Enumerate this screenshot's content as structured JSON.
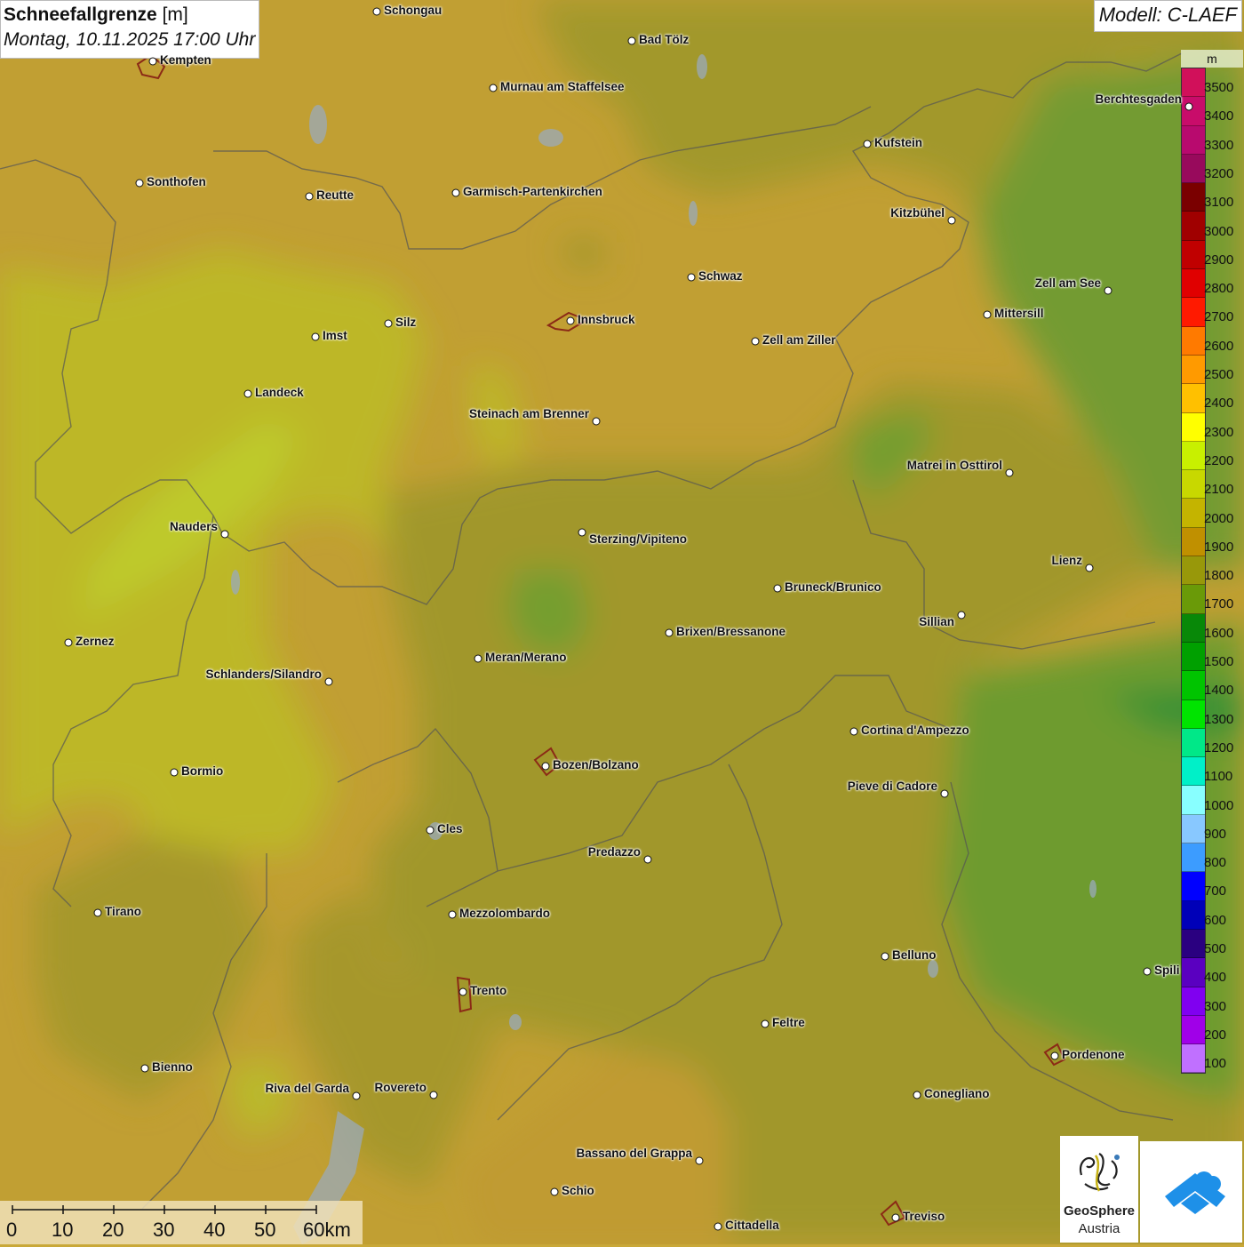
{
  "title": {
    "label_bold": "Schneefallgrenze",
    "unit": "[m]",
    "datetime": "Montag, 10.11.2025 17:00 Uhr"
  },
  "model": "Modell: C-LAEF",
  "legend": {
    "unit": "m",
    "levels": [
      {
        "value": "3500",
        "color": "#d1105a"
      },
      {
        "value": "3400",
        "color": "#c80c6a"
      },
      {
        "value": "3300",
        "color": "#b80a6e"
      },
      {
        "value": "3200",
        "color": "#980a5c"
      },
      {
        "value": "3100",
        "color": "#7a0000"
      },
      {
        "value": "3000",
        "color": "#a00000"
      },
      {
        "value": "2900",
        "color": "#c00000"
      },
      {
        "value": "2800",
        "color": "#e00000"
      },
      {
        "value": "2700",
        "color": "#ff1a00"
      },
      {
        "value": "2600",
        "color": "#ff7a00"
      },
      {
        "value": "2500",
        "color": "#ff9a00"
      },
      {
        "value": "2400",
        "color": "#ffc000"
      },
      {
        "value": "2300",
        "color": "#ffff00"
      },
      {
        "value": "2200",
        "color": "#c8f000"
      },
      {
        "value": "2100",
        "color": "#c8d800"
      },
      {
        "value": "2000",
        "color": "#c4b400"
      },
      {
        "value": "1900",
        "color": "#c09000"
      },
      {
        "value": "1800",
        "color": "#98980a"
      },
      {
        "value": "1700",
        "color": "#6a9a08"
      },
      {
        "value": "1600",
        "color": "#088808"
      },
      {
        "value": "1500",
        "color": "#00a000"
      },
      {
        "value": "1400",
        "color": "#00c400"
      },
      {
        "value": "1300",
        "color": "#00e400"
      },
      {
        "value": "1200",
        "color": "#00e888"
      },
      {
        "value": "1100",
        "color": "#00f0c8"
      },
      {
        "value": "1000",
        "color": "#88ffff"
      },
      {
        "value": "900",
        "color": "#88c8ff"
      },
      {
        "value": "800",
        "color": "#3c9cff"
      },
      {
        "value": "700",
        "color": "#0000ff"
      },
      {
        "value": "600",
        "color": "#0000b8"
      },
      {
        "value": "500",
        "color": "#2a0080"
      },
      {
        "value": "400",
        "color": "#5a00c0"
      },
      {
        "value": "300",
        "color": "#8000f0"
      },
      {
        "value": "200",
        "color": "#a000e8"
      },
      {
        "value": "100",
        "color": "#c070ff"
      }
    ]
  },
  "cities": [
    {
      "name": "Schongau"
    },
    {
      "name": "Kempten"
    },
    {
      "name": "Bad Tölz"
    },
    {
      "name": "Murnau am Staffelsee"
    },
    {
      "name": "Berchtesgaden"
    },
    {
      "name": "Kufstein"
    },
    {
      "name": "Sonthofen"
    },
    {
      "name": "Reutte"
    },
    {
      "name": "Garmisch-Partenkirchen"
    },
    {
      "name": "Kitzbühel"
    },
    {
      "name": "Schwaz"
    },
    {
      "name": "Zell am See"
    },
    {
      "name": "Innsbruck"
    },
    {
      "name": "Mittersill"
    },
    {
      "name": "Imst"
    },
    {
      "name": "Silz"
    },
    {
      "name": "Zell am Ziller"
    },
    {
      "name": "Landeck"
    },
    {
      "name": "Steinach am Brenner"
    },
    {
      "name": "Matrei in Osttirol"
    },
    {
      "name": "Nauders"
    },
    {
      "name": "Sterzing/Vipiteno"
    },
    {
      "name": "Lienz"
    },
    {
      "name": "Bruneck/Brunico"
    },
    {
      "name": "Sillian"
    },
    {
      "name": "Zernez"
    },
    {
      "name": "Brixen/Bressanone"
    },
    {
      "name": "Meran/Merano"
    },
    {
      "name": "Schlanders/Silandro"
    },
    {
      "name": "Cortina d'Ampezzo"
    },
    {
      "name": "Bormio"
    },
    {
      "name": "Bozen/Bolzano"
    },
    {
      "name": "Pieve di Cadore"
    },
    {
      "name": "Cles"
    },
    {
      "name": "Predazzo"
    },
    {
      "name": "Tirano"
    },
    {
      "name": "Mezzolombardo"
    },
    {
      "name": "Belluno"
    },
    {
      "name": "Spili"
    },
    {
      "name": "Trento"
    },
    {
      "name": "Feltre"
    },
    {
      "name": "Pordenone"
    },
    {
      "name": "Bienno"
    },
    {
      "name": "Riva del Garda"
    },
    {
      "name": "Rovereto"
    },
    {
      "name": "Conegliano"
    },
    {
      "name": "Bassano del Grappa"
    },
    {
      "name": "Schio"
    },
    {
      "name": "Treviso"
    },
    {
      "name": "Cittadella"
    }
  ],
  "scale": {
    "ticks": [
      "0",
      "10",
      "20",
      "30",
      "40",
      "50",
      "60km"
    ]
  },
  "logos": {
    "geosphere_name": "GeoSphere",
    "geosphere_sub": "Austria"
  }
}
